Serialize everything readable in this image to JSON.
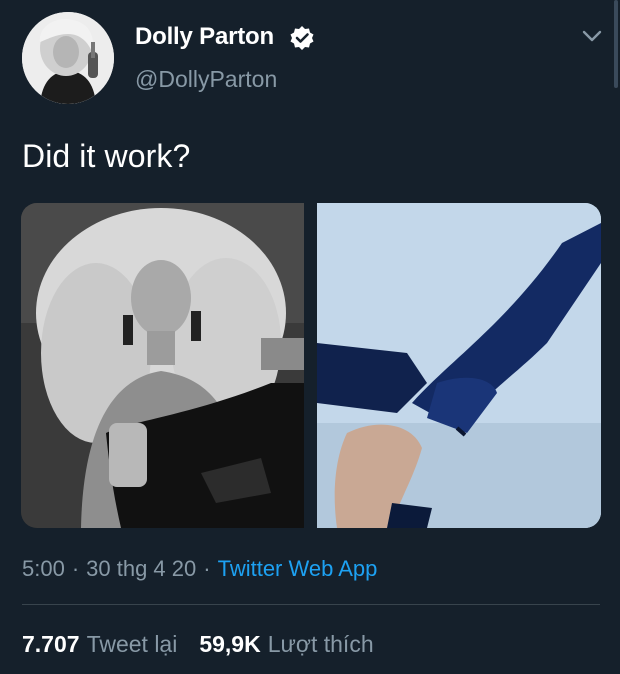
{
  "author": {
    "display_name": "Dolly Parton",
    "handle": "@DollyParton",
    "verified": true,
    "avatar_icon": "profile-photo",
    "verified_icon": "verified-badge-icon"
  },
  "tweet": {
    "text": "Did it work?",
    "media": [
      {
        "kind": "photo",
        "tone": "black-and-white"
      },
      {
        "kind": "photo",
        "tone": "blue"
      }
    ]
  },
  "meta": {
    "time": "5:00",
    "date": "30 thg 4 20",
    "separator": "·",
    "source": "Twitter Web App"
  },
  "stats": {
    "retweets_count": "7.707",
    "retweets_label": "Tweet lại",
    "likes_count": "59,9K",
    "likes_label": "Lượt thích"
  },
  "colors": {
    "background": "#15202b",
    "secondary_text": "#8899a6",
    "link": "#1da1f2",
    "divider": "#38444d"
  },
  "icons": {
    "menu": "chevron-down-icon",
    "verified": "verified-badge-icon"
  }
}
